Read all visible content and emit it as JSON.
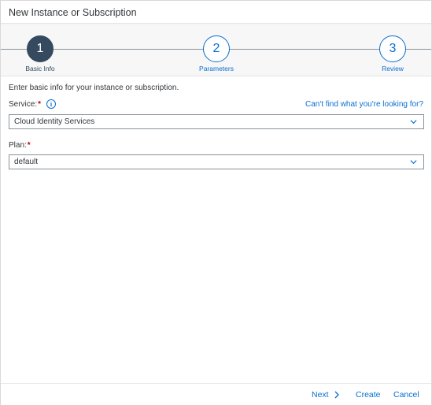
{
  "dialog": {
    "title": "New Instance or Subscription"
  },
  "wizard": {
    "steps": [
      {
        "number": "1",
        "label": "Basic Info",
        "active": true
      },
      {
        "number": "2",
        "label": "Parameters",
        "active": false
      },
      {
        "number": "3",
        "label": "Review",
        "active": false
      }
    ]
  },
  "form": {
    "intro": "Enter basic info for your instance or subscription.",
    "service": {
      "label": "Service:",
      "required_mark": "*",
      "info_icon": "info-icon",
      "help_link": "Can't find what you're looking for?",
      "value": "Cloud Identity Services"
    },
    "plan": {
      "label": "Plan:",
      "required_mark": "*",
      "value": "default"
    }
  },
  "footer": {
    "next_label": "Next",
    "create_label": "Create",
    "cancel_label": "Cancel"
  },
  "colors": {
    "accent": "#0a6ed1",
    "active_step": "#354a5f",
    "required": "#bb0000"
  }
}
